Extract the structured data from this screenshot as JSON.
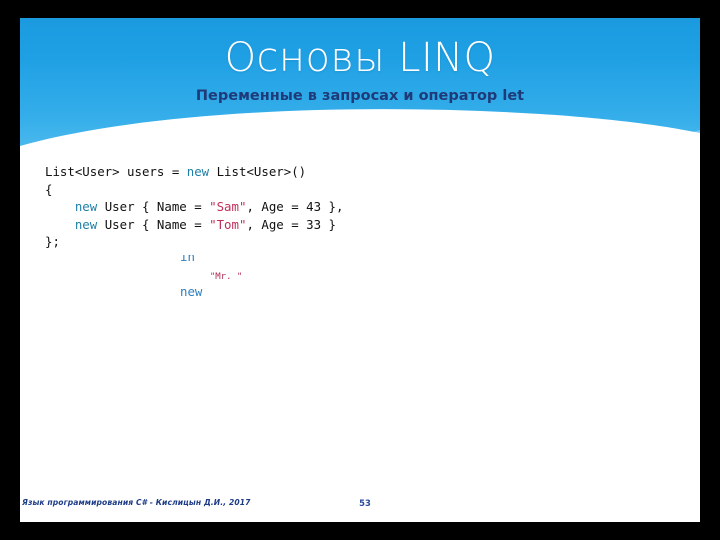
{
  "slide": {
    "title": "Основы LINQ",
    "subtitle": "Переменные в запросах и оператор let",
    "number": "53",
    "footer": "Язык программирования C# - Кислицын Д.И., 2017",
    "colors": {
      "header_top": "#1b9ae0",
      "header_bottom": "#c9eafb",
      "title_text": "#ffffff",
      "subtitle_text": "#1f3a78",
      "footer_text": "#1d3b86",
      "code_keyword": "#1f7fa8",
      "code_string": "#c0305a",
      "code_plain": "#111111",
      "canvas_background": "#000000",
      "card_background": "#ffffff"
    }
  },
  "code_block": {
    "language": "csharp",
    "lines": [
      [
        {
          "t": "List<User> users = ",
          "c": "plain"
        },
        {
          "t": "new",
          "c": "kw"
        },
        {
          "t": " List<User>()",
          "c": "plain"
        }
      ],
      [
        {
          "t": "{",
          "c": "plain"
        }
      ],
      [
        {
          "t": "    ",
          "c": "plain"
        },
        {
          "t": "new",
          "c": "kw"
        },
        {
          "t": " User { Name = ",
          "c": "plain"
        },
        {
          "t": "\"Sam\"",
          "c": "str"
        },
        {
          "t": ", Age = 43 },",
          "c": "plain"
        }
      ],
      [
        {
          "t": "    ",
          "c": "plain"
        },
        {
          "t": "new",
          "c": "kw"
        },
        {
          "t": " User { Name = ",
          "c": "plain"
        },
        {
          "t": "\"Tom\"",
          "c": "str"
        },
        {
          "t": ", Age = 33 }",
          "c": "plain"
        }
      ],
      [
        {
          "t": "};",
          "c": "plain"
        }
      ]
    ]
  },
  "code_block_partial": {
    "note": "second code block rendered only partially over dark background",
    "lines": [
      [
        {
          "t": "in",
          "c": "ghost-kw"
        }
      ],
      [
        {
          "t": "    ",
          "c": "ghost-dim"
        },
        {
          "t": "\"Mr. \"",
          "c": "ghost-str"
        }
      ],
      [
        {
          "t": "new",
          "c": "ghost-kw"
        }
      ]
    ]
  }
}
